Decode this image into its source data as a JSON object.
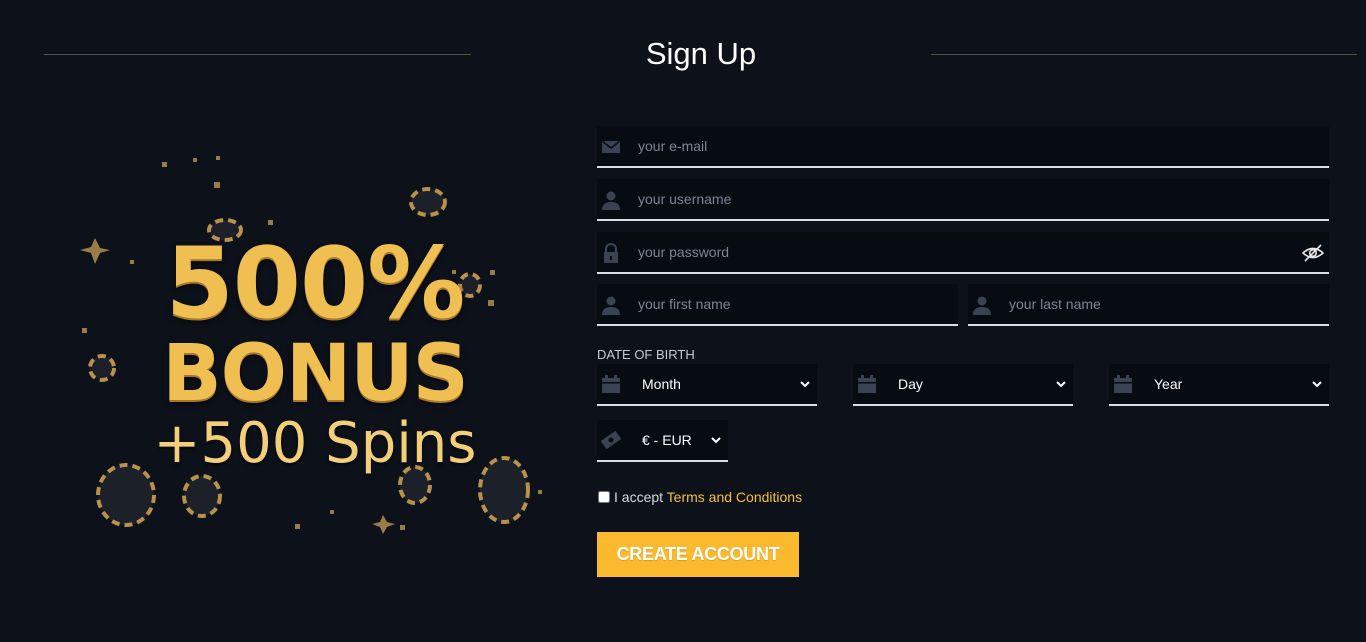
{
  "header": {
    "title": "Sign Up"
  },
  "promo": {
    "line1": "500%",
    "line2": "BONUS",
    "line3": "+500 Spins"
  },
  "form": {
    "email": {
      "placeholder": "your e-mail",
      "value": ""
    },
    "username": {
      "placeholder": "your username",
      "value": ""
    },
    "password": {
      "placeholder": "your password",
      "value": ""
    },
    "first_name": {
      "placeholder": "your first name",
      "value": ""
    },
    "last_name": {
      "placeholder": "your last name",
      "value": ""
    },
    "dob_label": "DATE OF BIRTH",
    "month": {
      "selected": "Month"
    },
    "day": {
      "selected": "Day"
    },
    "year": {
      "selected": "Year"
    },
    "currency": {
      "selected": "€ - EUR"
    },
    "terms": {
      "prefix": "I accept",
      "link": "Terms and Conditions",
      "checked": false
    },
    "submit_label": "CREATE ACCOUNT"
  },
  "icons": {
    "email": "envelope-icon",
    "user": "user-icon",
    "password": "lock-icon",
    "visibility": "eye-slash-icon",
    "calendar": "calendar-icon",
    "currency": "money-icon",
    "dropdown": "chevron-down-icon"
  },
  "colors": {
    "background": "#0d111a",
    "field_bg": "#070b12",
    "accent": "#fbb92d",
    "link": "#f7c02f",
    "gold": "#f0bf52",
    "icon": "#3a4354"
  }
}
